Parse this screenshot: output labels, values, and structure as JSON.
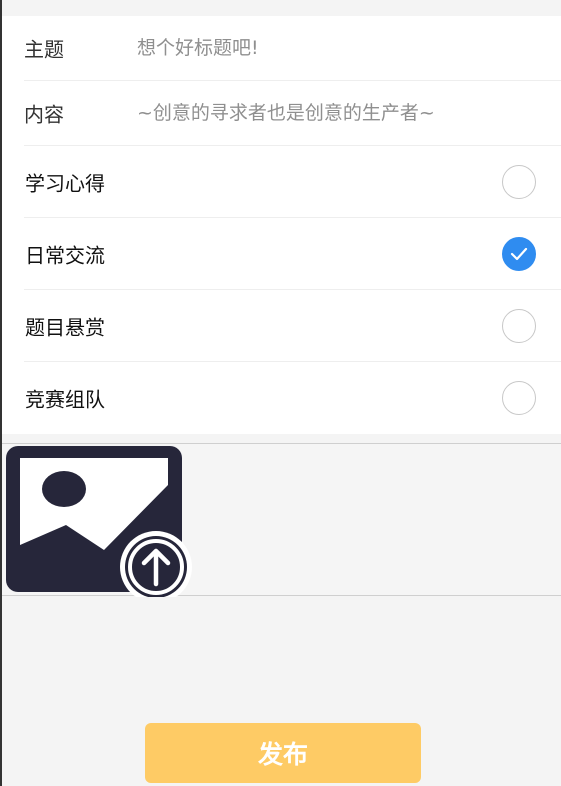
{
  "form": {
    "title_label": "主题",
    "title_placeholder": "想个好标题吧!",
    "content_label": "内容",
    "content_placeholder": "~创意的寻求者也是创意的生产者~"
  },
  "categories": [
    {
      "label": "学习心得",
      "selected": false
    },
    {
      "label": "日常交流",
      "selected": true
    },
    {
      "label": "题目悬赏",
      "selected": false
    },
    {
      "label": "竞赛组队",
      "selected": false
    }
  ],
  "upload": {
    "icon": "image-upload-icon"
  },
  "actions": {
    "publish_label": "发布"
  },
  "colors": {
    "selected": "#2f8cf0",
    "publish_button": "#fecb65",
    "icon": "#26263a"
  }
}
